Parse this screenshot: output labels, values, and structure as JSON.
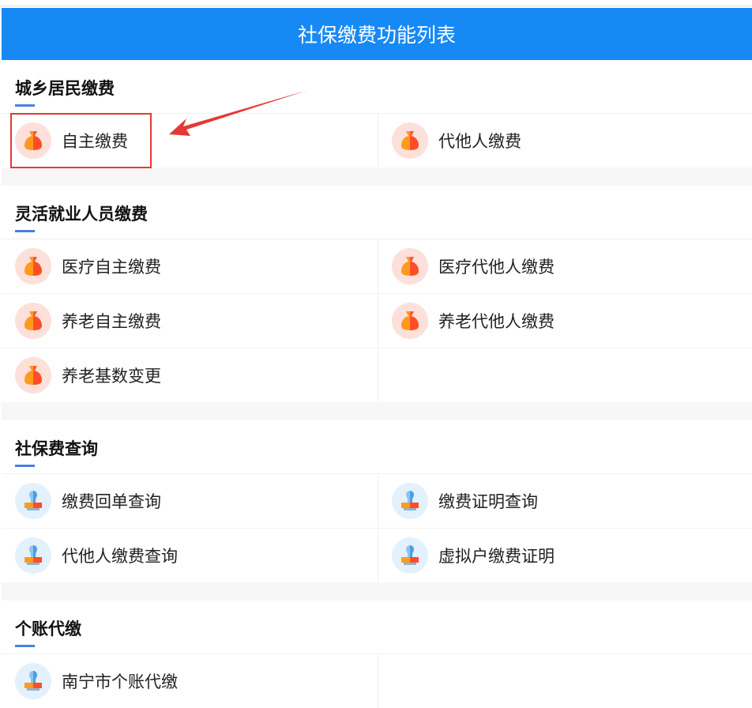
{
  "header": {
    "title": "社保缴费功能列表"
  },
  "sections": [
    {
      "title": "城乡居民缴费",
      "items": [
        {
          "label": "自主缴费",
          "icon": "money-bag-icon"
        },
        {
          "label": "代他人缴费",
          "icon": "money-bag-icon"
        }
      ]
    },
    {
      "title": "灵活就业人员缴费",
      "items": [
        {
          "label": "医疗自主缴费",
          "icon": "money-bag-icon"
        },
        {
          "label": "医疗代他人缴费",
          "icon": "money-bag-icon"
        },
        {
          "label": "养老自主缴费",
          "icon": "money-bag-icon"
        },
        {
          "label": "养老代他人缴费",
          "icon": "money-bag-icon"
        },
        {
          "label": "养老基数变更",
          "icon": "money-bag-icon"
        }
      ]
    },
    {
      "title": "社保费查询",
      "items": [
        {
          "label": "缴费回单查询",
          "icon": "stamp-icon"
        },
        {
          "label": "缴费证明查询",
          "icon": "stamp-icon"
        },
        {
          "label": "代他人缴费查询",
          "icon": "stamp-icon"
        },
        {
          "label": "虚拟户缴费证明",
          "icon": "stamp-icon"
        }
      ]
    },
    {
      "title": "个账代缴",
      "items": [
        {
          "label": "南宁市个账代缴",
          "icon": "stamp-icon"
        }
      ]
    }
  ],
  "colors": {
    "header": "#1789f5",
    "accent": "#4a7fe0",
    "highlight": "#e53935"
  }
}
